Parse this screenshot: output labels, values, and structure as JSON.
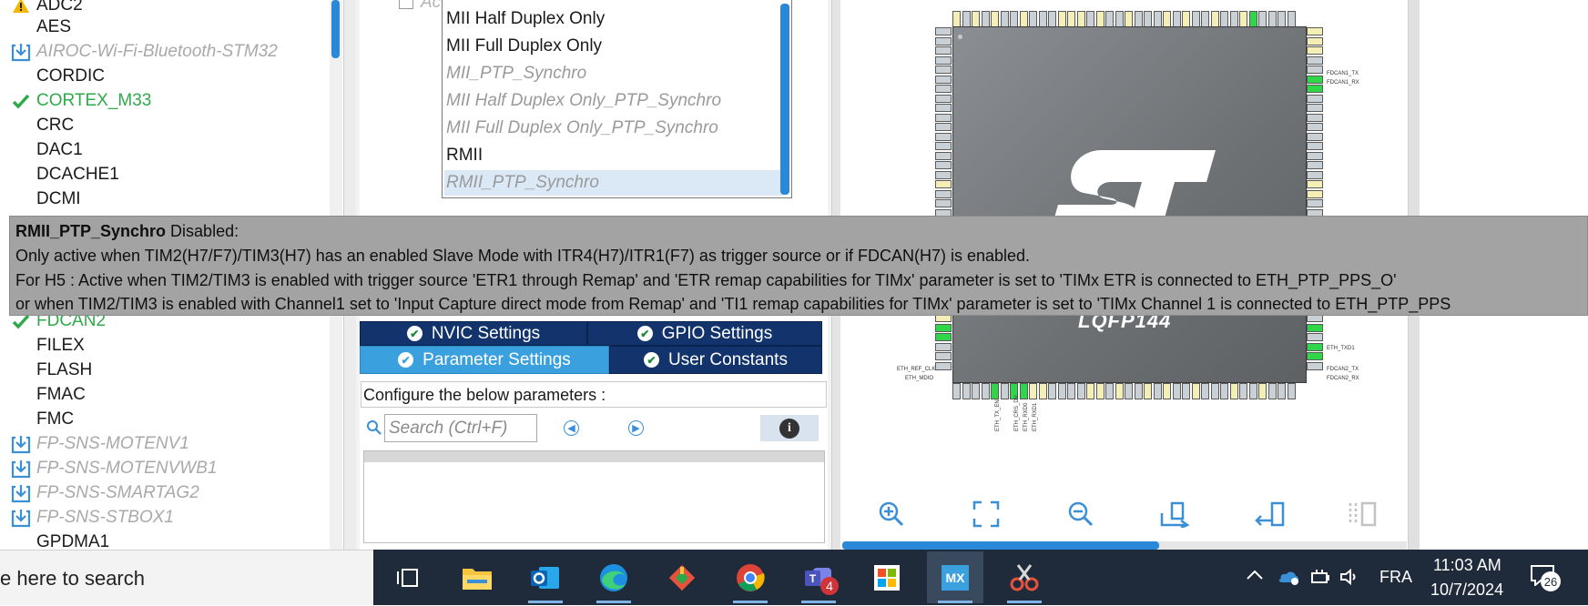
{
  "left_tree": {
    "items": [
      {
        "label": "ADC2",
        "icon": "warning-icon",
        "state": "plain"
      },
      {
        "label": "AES",
        "icon": "",
        "state": "plain"
      },
      {
        "label": "AIROC-Wi-Fi-Bluetooth-STM32",
        "icon": "pack-download-icon",
        "state": "pack"
      },
      {
        "label": "CORDIC",
        "icon": "",
        "state": "plain"
      },
      {
        "label": "CORTEX_M33",
        "icon": "check-icon",
        "state": "on"
      },
      {
        "label": "CRC",
        "icon": "",
        "state": "plain"
      },
      {
        "label": "DAC1",
        "icon": "",
        "state": "plain"
      },
      {
        "label": "DCACHE1",
        "icon": "",
        "state": "plain"
      },
      {
        "label": "DCMI",
        "icon": "",
        "state": "plain"
      },
      {
        "label": "FDCAN2",
        "icon": "check-icon",
        "state": "on"
      },
      {
        "label": "FILEX",
        "icon": "",
        "state": "plain"
      },
      {
        "label": "FLASH",
        "icon": "",
        "state": "plain"
      },
      {
        "label": "FMAC",
        "icon": "",
        "state": "plain"
      },
      {
        "label": "FMC",
        "icon": "",
        "state": "plain"
      },
      {
        "label": "FP-SNS-MOTENV1",
        "icon": "pack-download-icon",
        "state": "pack"
      },
      {
        "label": "FP-SNS-MOTENVWB1",
        "icon": "pack-download-icon",
        "state": "pack"
      },
      {
        "label": "FP-SNS-SMARTAG2",
        "icon": "pack-download-icon",
        "state": "pack"
      },
      {
        "label": "FP-SNS-STBOX1",
        "icon": "pack-download-icon",
        "state": "pack"
      },
      {
        "label": "GPDMA1",
        "icon": "",
        "state": "plain"
      }
    ]
  },
  "mode_dropdown": {
    "behind_label": "Ac",
    "options": [
      {
        "label": "MII Half Duplex Only",
        "enabled": true,
        "selected": false
      },
      {
        "label": "MII Full Duplex Only",
        "enabled": true,
        "selected": false
      },
      {
        "label": "MII_PTP_Synchro",
        "enabled": false,
        "selected": false
      },
      {
        "label": "MII Half Duplex Only_PTP_Synchro",
        "enabled": false,
        "selected": false
      },
      {
        "label": "MII Full Duplex Only_PTP_Synchro",
        "enabled": false,
        "selected": false
      },
      {
        "label": "RMII",
        "enabled": true,
        "selected": false
      },
      {
        "label": "RMII_PTP_Synchro",
        "enabled": false,
        "selected": true
      }
    ]
  },
  "config_tabs": {
    "nvic": "NVIC Settings",
    "gpio": "GPIO Settings",
    "parameter": "Parameter Settings",
    "user_constants": "User Constants",
    "active": "parameter"
  },
  "configure": {
    "caption": "Configure the below parameters :",
    "search_placeholder": "Search (Ctrl+F)",
    "info_icon": "info-icon"
  },
  "tooltip": {
    "title": "RMII_PTP_Synchro",
    "title_suffix": " Disabled:",
    "line1": "Only active when TIM2(H7/F7)/TIM3(H7) has an enabled Slave Mode with ITR4(H7)/ITR1(F7) as trigger source or if FDCAN(H7) is enabled.",
    "line2": "For H5 : Active when TIM2/TIM3 is enabled with trigger source 'ETR1 through Remap' and 'ETR remap capabilities for TIMx' parameter is set to 'TIMx ETR is connected to ETH_PTP_PPS_O'",
    "line3": "or when TIM2/TIM3 is enabled with Channel1 set to 'Input Capture direct mode from Remap' and 'TI1 remap capabilities for TIMx' parameter is set to 'TIMx Channel 1 is connected to ETH_PTP_PPS"
  },
  "pinout": {
    "chip_name": "LQFP144",
    "logo": "ST",
    "labels_right": [
      "FDCAN1_TX",
      "FDCAN1_RX",
      "ETH_TXD1",
      "FDCAN2_TX",
      "FDCAN2_RX"
    ],
    "labels_left": [
      "ETH_REF_CLK",
      "ETH_MDIO"
    ],
    "labels_bottom": [
      "ETH_TX_EN",
      "ETH_CRS_DV",
      "ETH_RXD0",
      "ETH_RXD1"
    ],
    "tools": [
      "zoom-in-icon",
      "fit-screen-icon",
      "zoom-out-icon",
      "rotate-right-icon",
      "rotate-left-icon",
      "split-view-icon"
    ]
  },
  "taskbar": {
    "search_text": "e here to search",
    "apps": [
      {
        "name": "task-view-icon",
        "running": false,
        "active": false
      },
      {
        "name": "file-explorer-icon",
        "running": false,
        "active": false
      },
      {
        "name": "outlook-icon",
        "running": true,
        "active": false
      },
      {
        "name": "edge-icon",
        "running": true,
        "active": false
      },
      {
        "name": "git-icon",
        "running": false,
        "active": false
      },
      {
        "name": "chrome-icon",
        "running": true,
        "active": false
      },
      {
        "name": "teams-icon",
        "running": true,
        "active": false,
        "badge": "4"
      },
      {
        "name": "store-icon",
        "running": false,
        "active": false
      },
      {
        "name": "stm32cubemx-icon",
        "running": true,
        "active": true,
        "label": "MX"
      },
      {
        "name": "snipping-tool-icon",
        "running": true,
        "active": false
      }
    ],
    "tray": {
      "language": "FRA",
      "time": "11:03 AM",
      "date": "10/7/2024",
      "notifications": "26"
    }
  }
}
